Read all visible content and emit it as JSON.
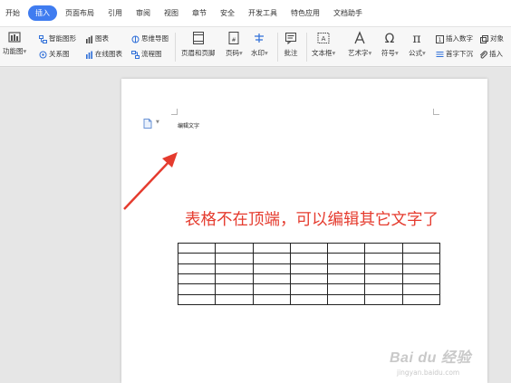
{
  "tabs": [
    "开始",
    "插入",
    "页面布局",
    "引用",
    "审阅",
    "视图",
    "章节",
    "安全",
    "开发工具",
    "特色应用",
    "文档助手"
  ],
  "active_tab_index": 1,
  "ribbon": {
    "function_diagram": "功能图",
    "smart_shape": "智能图形",
    "chart": "图表",
    "mind_map": "思维导图",
    "relation_graph": "关系图",
    "online_chart": "在线图表",
    "flowchart": "流程图",
    "header_footer": "页眉和页脚",
    "page_number": "页码",
    "watermark": "水印",
    "comment": "批注",
    "text_box": "文本框",
    "word_art": "艺术字",
    "symbol": "符号",
    "formula": "公式",
    "insert_number": "插入数字",
    "object": "对象",
    "drop_cap": "首字下沉",
    "insert_attachment": "插入"
  },
  "document": {
    "header_text": "编辑文字",
    "annotation": "表格不在顶端，可以编辑其它文字了",
    "table": {
      "rows": 6,
      "cols": 7
    }
  },
  "watermark": {
    "logo": "Bai du 经验",
    "url": "jingyan.baidu.com"
  },
  "colors": {
    "accent": "#3f7cf0",
    "annotation": "#e53b2e"
  }
}
